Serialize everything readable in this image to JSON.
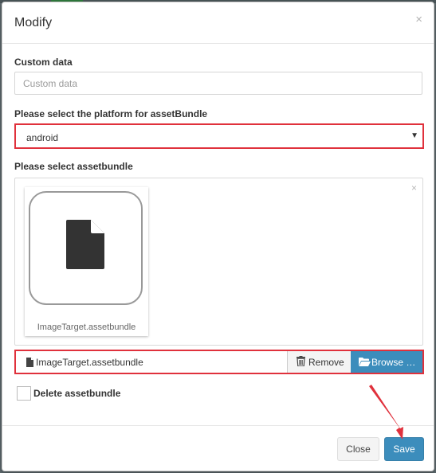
{
  "dialog": {
    "title": "Modify",
    "close_icon": "×"
  },
  "custom_data": {
    "label": "Custom data",
    "placeholder": "Custom data",
    "value": ""
  },
  "platform": {
    "label": "Please select the platform for assetBundle",
    "selected": "android",
    "caret": "▼"
  },
  "assetbundle": {
    "label": "Please select assetbundle",
    "clear_icon": "×",
    "preview_caption": "ImageTarget.assetbundle",
    "file_name": "ImageTarget.assetbundle",
    "remove_label": "Remove",
    "browse_label": "Browse …"
  },
  "delete_assetbundle": {
    "label": "Delete assetbundle",
    "checked": false
  },
  "footer": {
    "close_label": "Close",
    "save_label": "Save"
  },
  "colors": {
    "accent": "#3c8dbc",
    "highlight": "#e0313c"
  },
  "icons": [
    "file-icon",
    "trash-icon",
    "folder-open-icon",
    "close-icon",
    "caret-down-icon"
  ]
}
